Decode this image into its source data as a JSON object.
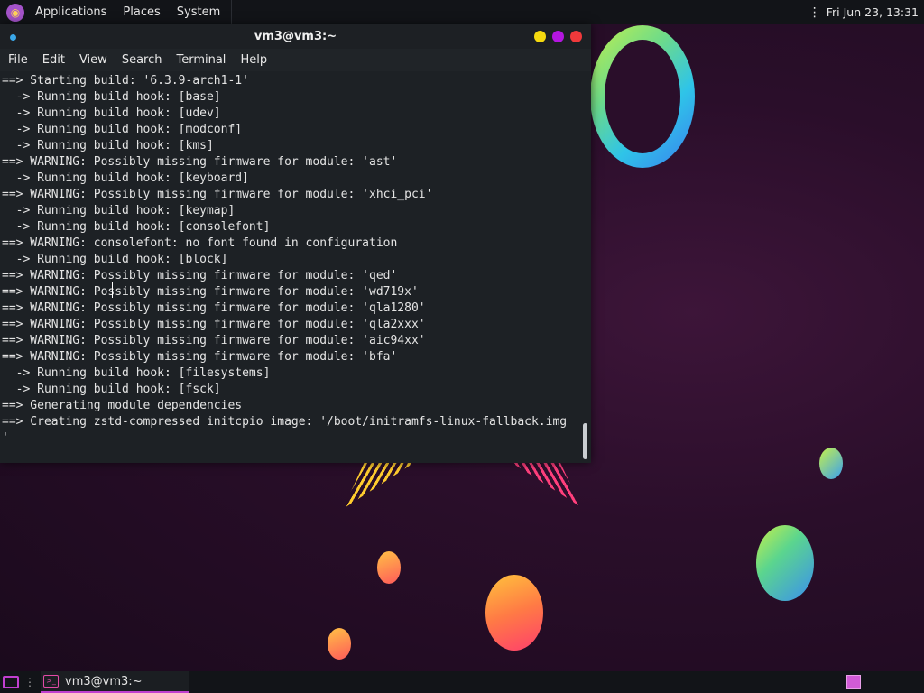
{
  "top_panel": {
    "menus": [
      "Applications",
      "Places",
      "System"
    ],
    "clock": "Fri Jun 23, 13:31"
  },
  "terminal": {
    "title": "vm3@vm3:~",
    "menus": [
      "File",
      "Edit",
      "View",
      "Search",
      "Terminal",
      "Help"
    ],
    "output": "==> Starting build: '6.3.9-arch1-1'\n  -> Running build hook: [base]\n  -> Running build hook: [udev]\n  -> Running build hook: [modconf]\n  -> Running build hook: [kms]\n==> WARNING: Possibly missing firmware for module: 'ast'\n  -> Running build hook: [keyboard]\n==> WARNING: Possibly missing firmware for module: 'xhci_pci'\n  -> Running build hook: [keymap]\n  -> Running build hook: [consolefont]\n==> WARNING: consolefont: no font found in configuration\n  -> Running build hook: [block]\n==> WARNING: Possibly missing firmware for module: 'qed'\n==> WARNING: Possibly missing firmware for module: 'wd719x'\n==> WARNING: Possibly missing firmware for module: 'qla1280'\n==> WARNING: Possibly missing firmware for module: 'qla2xxx'\n==> WARNING: Possibly missing firmware for module: 'aic94xx'\n==> WARNING: Possibly missing firmware for module: 'bfa'\n  -> Running build hook: [filesystems]\n  -> Running build hook: [fsck]\n==> Generating module dependencies\n==> Creating zstd-compressed initcpio image: '/boot/initramfs-linux-fallback.img\n'",
    "window_buttons": [
      {
        "name": "minimize",
        "color": "#f5d90f"
      },
      {
        "name": "maximize",
        "color": "#b416e0"
      },
      {
        "name": "close",
        "color": "#f0393b"
      }
    ]
  },
  "taskbar": {
    "task_label": "vm3@vm3:~"
  },
  "colors": {
    "accent": "#c03fcf",
    "terminal_bg": "#1d2125",
    "panel_bg": "#121418"
  }
}
